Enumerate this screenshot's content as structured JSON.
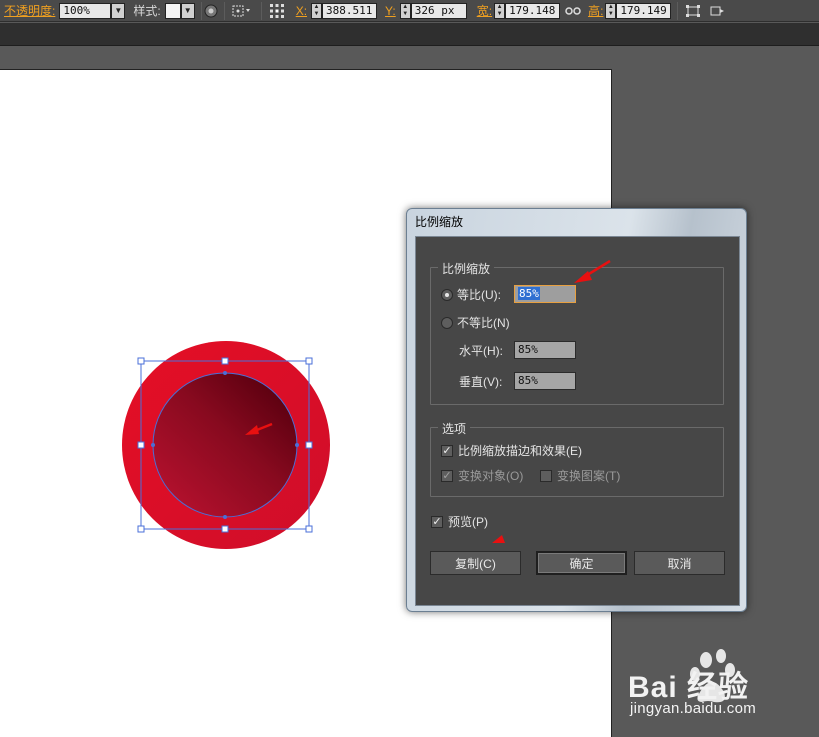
{
  "control_bar": {
    "opacity_label": "不透明度:",
    "opacity_value": "100%",
    "style_label": "样式:",
    "x_label": "X:",
    "x_value": "388.511",
    "y_label": "Y:",
    "y_value": "326 px",
    "width_label": "宽:",
    "width_value": "179.148",
    "height_label": "高:",
    "height_value": "179.149"
  },
  "dialog": {
    "title": "比例缩放",
    "scale_group": {
      "title": "比例缩放",
      "uniform_label": "等比(U):",
      "uniform_value": "85%",
      "uniform_selected": true,
      "nonuniform_label": "不等比(N)",
      "horizontal_label": "水平(H):",
      "horizontal_value": "85%",
      "vertical_label": "垂直(V):",
      "vertical_value": "85%"
    },
    "options_group": {
      "title": "选项",
      "scale_strokes_label": "比例缩放描边和效果(E)",
      "scale_strokes_checked": true,
      "transform_objects_label": "变换对象(O)",
      "transform_objects_checked": true,
      "transform_patterns_label": "变换图案(T)",
      "transform_patterns_checked": false
    },
    "preview_label": "预览(P)",
    "preview_checked": true,
    "copy_button": "复制(C)",
    "ok_button": "确定",
    "cancel_button": "取消"
  },
  "colors": {
    "outer_circle": "#d8102a",
    "inner_gradient_start": "#9a0a22",
    "inner_gradient_end": "#6a0012",
    "selection": "#4a6fd8",
    "annotation_arrow": "#e81010"
  },
  "watermark": {
    "brand": "Bai 经验",
    "url": "jingyan.baidu.com"
  }
}
